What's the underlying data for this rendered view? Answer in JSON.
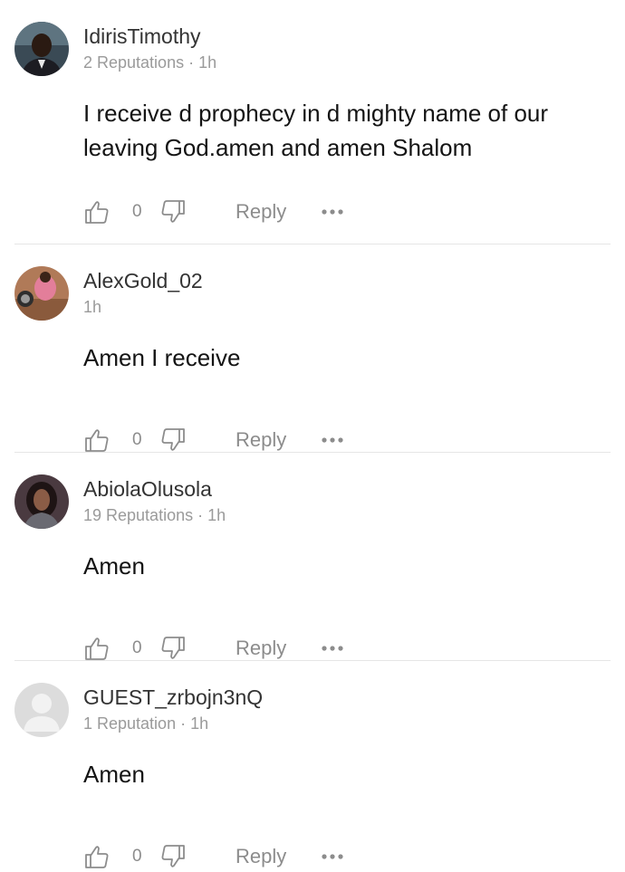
{
  "comments": [
    {
      "username": "IdirisTimothy",
      "meta": "2 Reputations · 1h",
      "text": "I receive d prophecy in d mighty name of our leaving God.amen and amen Shalom",
      "likes": "0",
      "reply_label": "Reply"
    },
    {
      "username": "AlexGold_02",
      "meta": "1h",
      "text": "Amen I receive",
      "likes": "0",
      "reply_label": "Reply"
    },
    {
      "username": "AbiolaOlusola",
      "meta": "19 Reputations · 1h",
      "text": "Amen",
      "likes": "0",
      "reply_label": "Reply"
    },
    {
      "username": "GUEST_zrbojn3nQ",
      "meta": "1 Reputation · 1h",
      "text": "Amen",
      "likes": "0",
      "reply_label": "Reply"
    }
  ],
  "colors": {
    "text": "#141414",
    "secondary": "#9a9a9a",
    "icon": "#8c8c8c",
    "divider": "#e6e6e6"
  }
}
